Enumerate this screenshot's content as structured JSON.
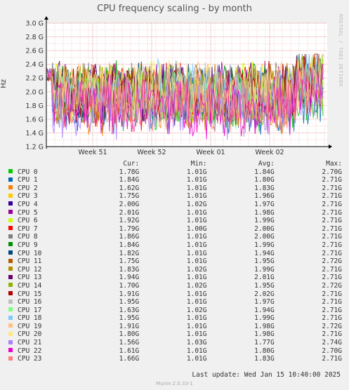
{
  "chart_data": {
    "type": "line",
    "title": "CPU frequency scaling - by month",
    "ylabel": "Hz",
    "ylim": [
      1.2,
      3.0
    ],
    "yticks": [
      "1.2 G",
      "1.4 G",
      "1.6 G",
      "1.8 G",
      "2.0 G",
      "2.2 G",
      "2.4 G",
      "2.6 G",
      "2.8 G",
      "3.0 G"
    ],
    "xticks": [
      "Week 51",
      "Week 52",
      "Week 01",
      "Week 02"
    ],
    "grid": true,
    "columns": [
      "Cur:",
      "Min:",
      "Avg:",
      "Max:"
    ],
    "series": [
      {
        "name": "CPU 0",
        "color": "#00cc00",
        "cur": "1.78G",
        "min": "1.01G",
        "avg": "1.84G",
        "max": "2.70G"
      },
      {
        "name": "CPU 1",
        "color": "#0066b3",
        "cur": "1.84G",
        "min": "1.01G",
        "avg": "1.80G",
        "max": "2.71G"
      },
      {
        "name": "CPU 2",
        "color": "#ff8000",
        "cur": "1.62G",
        "min": "1.01G",
        "avg": "1.83G",
        "max": "2.71G"
      },
      {
        "name": "CPU 3",
        "color": "#ffcc00",
        "cur": "1.75G",
        "min": "1.01G",
        "avg": "1.96G",
        "max": "2.71G"
      },
      {
        "name": "CPU 4",
        "color": "#330099",
        "cur": "2.00G",
        "min": "1.02G",
        "avg": "1.97G",
        "max": "2.71G"
      },
      {
        "name": "CPU 5",
        "color": "#990099",
        "cur": "2.01G",
        "min": "1.01G",
        "avg": "1.98G",
        "max": "2.71G"
      },
      {
        "name": "CPU 6",
        "color": "#ccff00",
        "cur": "1.92G",
        "min": "1.01G",
        "avg": "1.99G",
        "max": "2.71G"
      },
      {
        "name": "CPU 7",
        "color": "#ff0000",
        "cur": "1.79G",
        "min": "1.00G",
        "avg": "2.00G",
        "max": "2.71G"
      },
      {
        "name": "CPU 8",
        "color": "#808080",
        "cur": "1.86G",
        "min": "1.01G",
        "avg": "2.00G",
        "max": "2.71G"
      },
      {
        "name": "CPU 9",
        "color": "#008f00",
        "cur": "1.84G",
        "min": "1.01G",
        "avg": "1.99G",
        "max": "2.71G"
      },
      {
        "name": "CPU 10",
        "color": "#00487d",
        "cur": "1.82G",
        "min": "1.01G",
        "avg": "1.94G",
        "max": "2.71G"
      },
      {
        "name": "CPU 11",
        "color": "#b35a00",
        "cur": "1.75G",
        "min": "1.01G",
        "avg": "1.95G",
        "max": "2.72G"
      },
      {
        "name": "CPU 12",
        "color": "#b38f00",
        "cur": "1.83G",
        "min": "1.02G",
        "avg": "1.99G",
        "max": "2.71G"
      },
      {
        "name": "CPU 13",
        "color": "#6b006b",
        "cur": "1.94G",
        "min": "1.01G",
        "avg": "2.01G",
        "max": "2.71G"
      },
      {
        "name": "CPU 14",
        "color": "#8fb300",
        "cur": "1.70G",
        "min": "1.02G",
        "avg": "1.95G",
        "max": "2.72G"
      },
      {
        "name": "CPU 15",
        "color": "#b30000",
        "cur": "1.91G",
        "min": "1.01G",
        "avg": "2.02G",
        "max": "2.71G"
      },
      {
        "name": "CPU 16",
        "color": "#bebebe",
        "cur": "1.95G",
        "min": "1.01G",
        "avg": "1.97G",
        "max": "2.71G"
      },
      {
        "name": "CPU 17",
        "color": "#80ff80",
        "cur": "1.63G",
        "min": "1.02G",
        "avg": "1.94G",
        "max": "2.71G"
      },
      {
        "name": "CPU 18",
        "color": "#80c9ff",
        "cur": "1.95G",
        "min": "1.01G",
        "avg": "1.99G",
        "max": "2.71G"
      },
      {
        "name": "CPU 19",
        "color": "#ffc080",
        "cur": "1.91G",
        "min": "1.01G",
        "avg": "1.98G",
        "max": "2.72G"
      },
      {
        "name": "CPU 20",
        "color": "#ffe680",
        "cur": "1.80G",
        "min": "1.01G",
        "avg": "1.98G",
        "max": "2.71G"
      },
      {
        "name": "CPU 21",
        "color": "#aa80ff",
        "cur": "1.56G",
        "min": "1.03G",
        "avg": "1.77G",
        "max": "2.74G"
      },
      {
        "name": "CPU 22",
        "color": "#ee00cc",
        "cur": "1.61G",
        "min": "1.01G",
        "avg": "1.80G",
        "max": "2.70G"
      },
      {
        "name": "CPU 23",
        "color": "#ff8080",
        "cur": "1.66G",
        "min": "1.01G",
        "avg": "1.83G",
        "max": "2.71G"
      }
    ]
  },
  "side_label": "RRDTOOL / TOBI OETIKER",
  "footer": {
    "last_update": "Last update:  Wed Jan 15 10:40:00 2025",
    "version": "Munin 2.0.33-1"
  }
}
